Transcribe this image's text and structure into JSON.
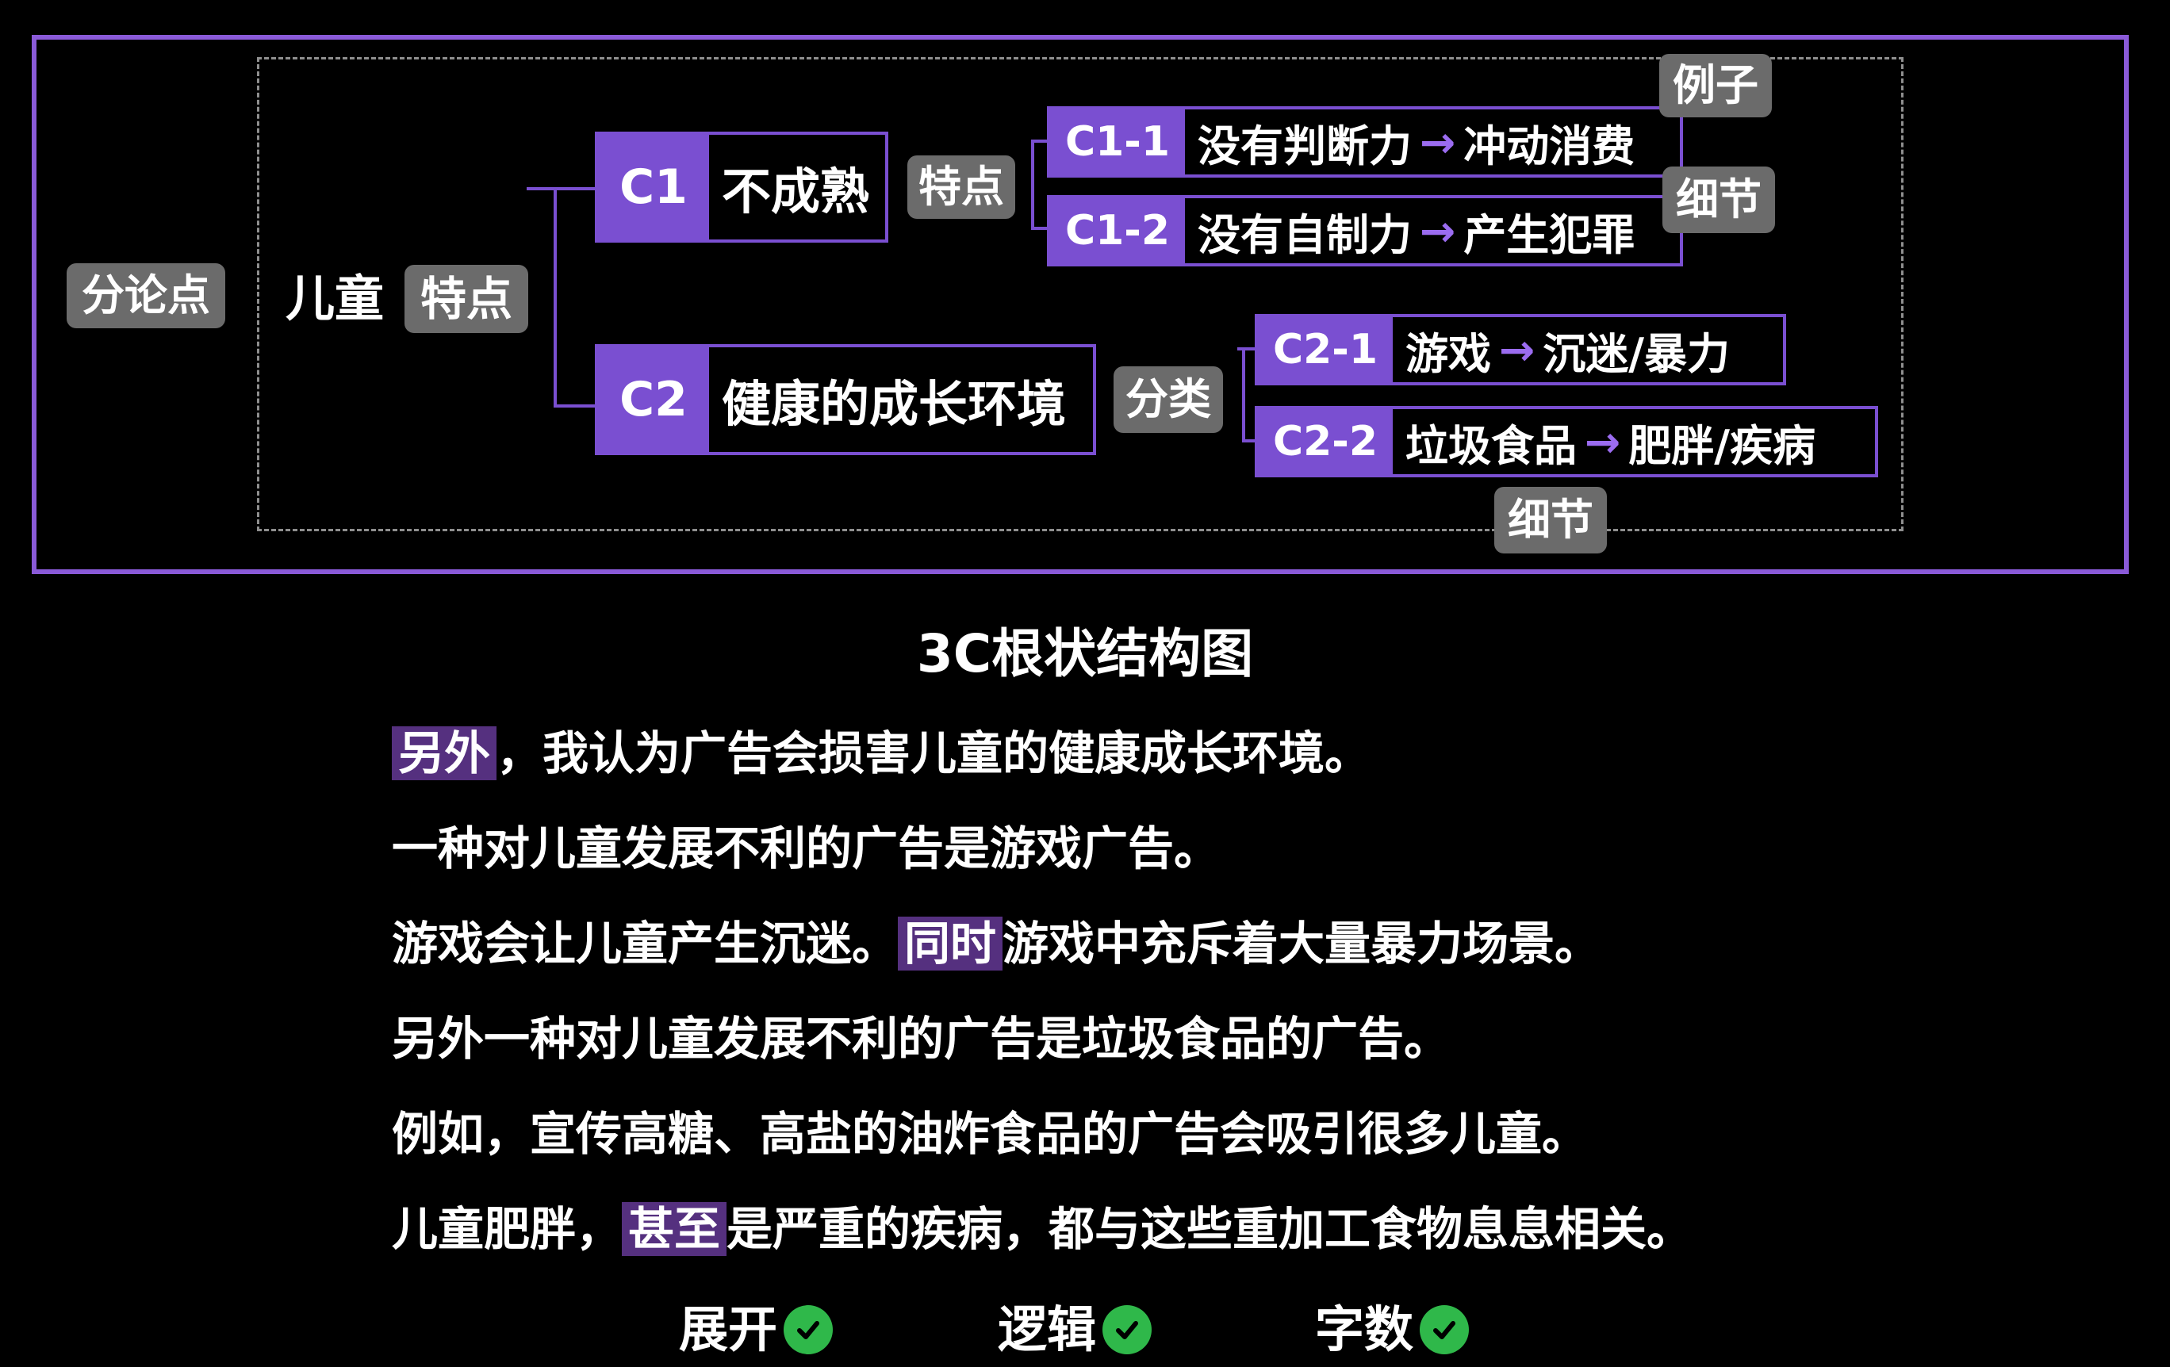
{
  "diagram": {
    "label_fenlundian": "分论点",
    "root": "儿童",
    "root_tag": "特点",
    "c1": {
      "id": "C1",
      "text": "不成熟",
      "tag": "特点"
    },
    "c1_1": {
      "id": "C1-1",
      "left": "没有判断力",
      "arrow": "→",
      "right": "冲动消费"
    },
    "c1_2": {
      "id": "C1-2",
      "left": "没有自制力",
      "arrow": "→",
      "right": "产生犯罪"
    },
    "tag_example": "例子",
    "tag_detail_1": "细节",
    "c2": {
      "id": "C2",
      "text": "健康的成长环境",
      "tag": "分类"
    },
    "c2_1": {
      "id": "C2-1",
      "left": "游戏",
      "arrow": "→",
      "right": "沉迷/暴力"
    },
    "c2_2": {
      "id": "C2-2",
      "left": "垃圾食品",
      "arrow": "→",
      "right": "肥胖/疾病"
    },
    "tag_detail_2": "细节"
  },
  "title": "3C根状结构图",
  "lines": [
    {
      "hl": "另外",
      "rest": "，我认为广告会损害儿童的健康成长环境。"
    },
    {
      "text": "一种对儿童发展不利的广告是游戏广告。"
    },
    {
      "pre": "游戏会让儿童产生沉迷。",
      "hl": "同时",
      "rest": "游戏中充斥着大量暴力场景。"
    },
    {
      "text": "另外一种对儿童发展不利的广告是垃圾食品的广告。"
    },
    {
      "text": "例如，宣传高糖、高盐的油炸食品的广告会吸引很多儿童。"
    },
    {
      "pre": "儿童肥胖，",
      "hl": "甚至",
      "rest": "是严重的疾病，都与这些重加工食物息息相关。"
    }
  ],
  "footer": [
    "展开",
    "逻辑",
    "字数"
  ],
  "colors": {
    "accent": "#7a4fd1",
    "frame": "#8a5ad8",
    "tag": "#6b6b6b",
    "check": "#2fb84a",
    "highlight": "#55307f"
  }
}
